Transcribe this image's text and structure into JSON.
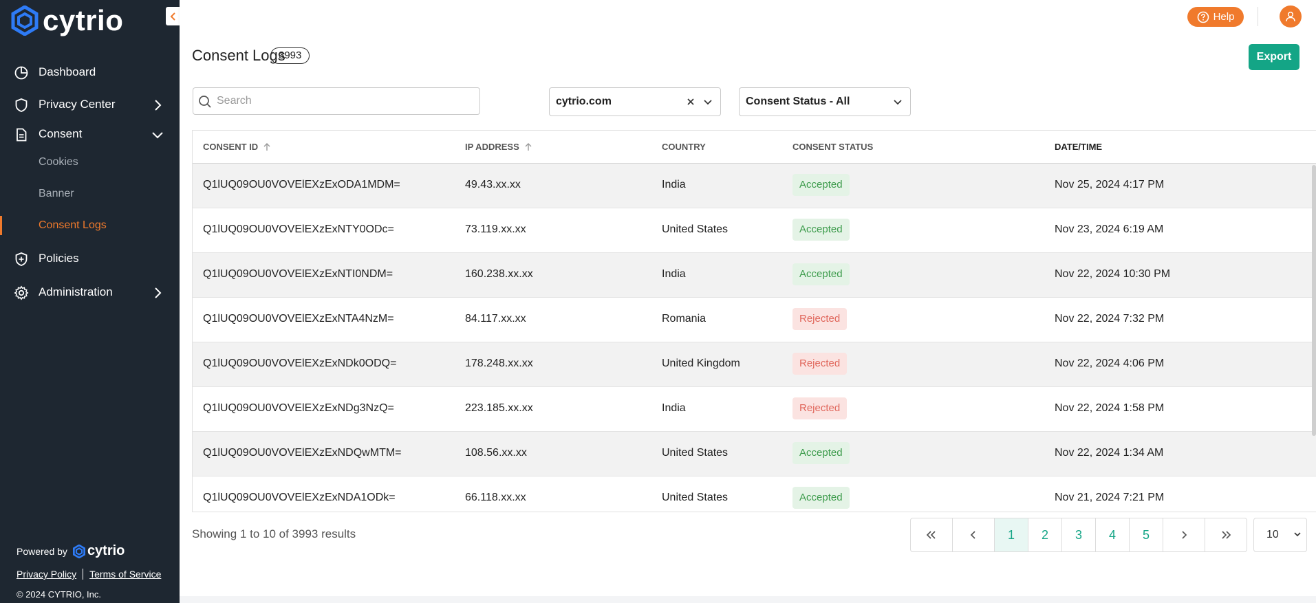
{
  "brand": {
    "name": "cytrio"
  },
  "sidebar": {
    "items": [
      {
        "label": "Dashboard"
      },
      {
        "label": "Privacy Center"
      },
      {
        "label": "Consent"
      },
      {
        "label": "Policies"
      },
      {
        "label": "Administration"
      }
    ],
    "consent_sub": [
      {
        "label": "Cookies"
      },
      {
        "label": "Banner"
      },
      {
        "label": "Consent Logs"
      }
    ],
    "footer": {
      "powered_by": "Powered by",
      "brand": "cytrio",
      "privacy_policy": "Privacy Policy",
      "terms": "Terms of Service",
      "copyright": "© 2024 CYTRIO, Inc."
    }
  },
  "topbar": {
    "help_label": "Help"
  },
  "page": {
    "title": "Consent Logs",
    "count": "3993",
    "export_label": "Export"
  },
  "filters": {
    "search_placeholder": "Search",
    "domain_value": "cytrio.com",
    "status_value": "Consent Status - All"
  },
  "table": {
    "headers": [
      "CONSENT ID",
      "IP ADDRESS",
      "COUNTRY",
      "CONSENT STATUS",
      "DATE/TIME"
    ],
    "rows": [
      {
        "id": "Q1lUQ09OU0VOVElEXzExODA1MDM=",
        "ip": "49.43.xx.xx",
        "country": "India",
        "status": "Accepted",
        "datetime": "Nov 25, 2024 4:17 PM"
      },
      {
        "id": "Q1lUQ09OU0VOVElEXzExNTY0ODc=",
        "ip": "73.119.xx.xx",
        "country": "United States",
        "status": "Accepted",
        "datetime": "Nov 23, 2024 6:19 AM"
      },
      {
        "id": "Q1lUQ09OU0VOVElEXzExNTI0NDM=",
        "ip": "160.238.xx.xx",
        "country": "India",
        "status": "Accepted",
        "datetime": "Nov 22, 2024 10:30 PM"
      },
      {
        "id": "Q1lUQ09OU0VOVElEXzExNTA4NzM=",
        "ip": "84.117.xx.xx",
        "country": "Romania",
        "status": "Rejected",
        "datetime": "Nov 22, 2024 7:32 PM"
      },
      {
        "id": "Q1lUQ09OU0VOVElEXzExNDk0ODQ=",
        "ip": "178.248.xx.xx",
        "country": "United Kingdom",
        "status": "Rejected",
        "datetime": "Nov 22, 2024 4:06 PM"
      },
      {
        "id": "Q1lUQ09OU0VOVElEXzExNDg3NzQ=",
        "ip": "223.185.xx.xx",
        "country": "India",
        "status": "Rejected",
        "datetime": "Nov 22, 2024 1:58 PM"
      },
      {
        "id": "Q1lUQ09OU0VOVElEXzExNDQwMTM=",
        "ip": "108.56.xx.xx",
        "country": "United States",
        "status": "Accepted",
        "datetime": "Nov 22, 2024 1:34 AM"
      },
      {
        "id": "Q1lUQ09OU0VOVElEXzExNDA1ODk=",
        "ip": "66.118.xx.xx",
        "country": "United States",
        "status": "Accepted",
        "datetime": "Nov 21, 2024 7:21 PM"
      }
    ]
  },
  "pagination": {
    "summary": "Showing 1 to 10 of 3993 results",
    "pages": [
      "1",
      "2",
      "3",
      "4",
      "5"
    ],
    "current": "1",
    "per_page": "10"
  },
  "colors": {
    "sidebar_bg": "#1e2731",
    "accent_orange": "#f07a2c",
    "accent_green": "#14a586",
    "accepted_text": "#3c9b4b",
    "rejected_text": "#e0665b"
  }
}
